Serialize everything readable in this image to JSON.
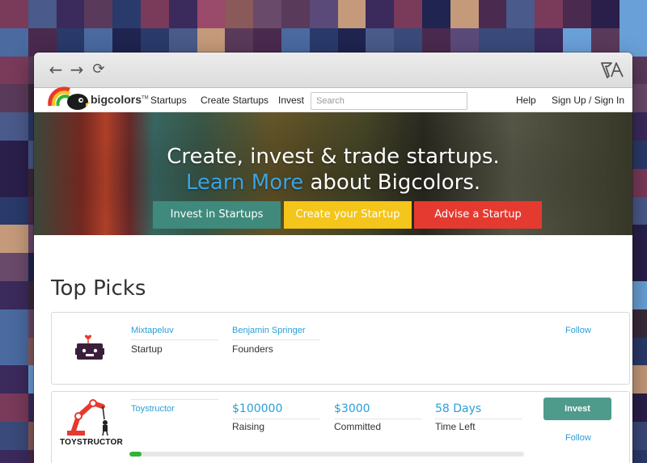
{
  "colors": {
    "teal": "#3f8a7c",
    "yellow": "#f4c51a",
    "red": "#e53a30",
    "link_blue": "#2a9fd6",
    "progress_green": "#34b233"
  },
  "browser": {
    "back_icon": "arrow-left-icon",
    "forward_icon": "arrow-right-icon",
    "reload_icon": "reload-icon",
    "brand_icon": "ta-logo-icon"
  },
  "header": {
    "logo_text": "bigcolors",
    "logo_tm": "TM",
    "nav": [
      "Startups",
      "Create Startups",
      "Invest"
    ],
    "search_placeholder": "Search",
    "right_links": [
      "Help",
      "Sign Up / Sign In"
    ]
  },
  "hero": {
    "headline": "Create, invest & trade startups.",
    "learn_more": "Learn More",
    "about": "about Bigcolors.",
    "buttons": [
      "Invest in Startups",
      "Create your Startup",
      "Advise a Startup"
    ]
  },
  "top_picks": {
    "title": "Top Picks",
    "cards": [
      {
        "name": "Mixtapeluv",
        "type": "Startup",
        "founder": "Benjamin Springer",
        "founder_label": "Founders",
        "follow": "Follow"
      },
      {
        "name": "Toystructor",
        "logo_text": "TOYSTRUCTOR",
        "raising": "$100000",
        "raising_label": "Raising",
        "committed": "$3000",
        "committed_label": "Committed",
        "time_left": "58 Days",
        "time_left_label": "Time Left",
        "invest": "Invest",
        "follow": "Follow",
        "progress": 0.03
      }
    ]
  }
}
